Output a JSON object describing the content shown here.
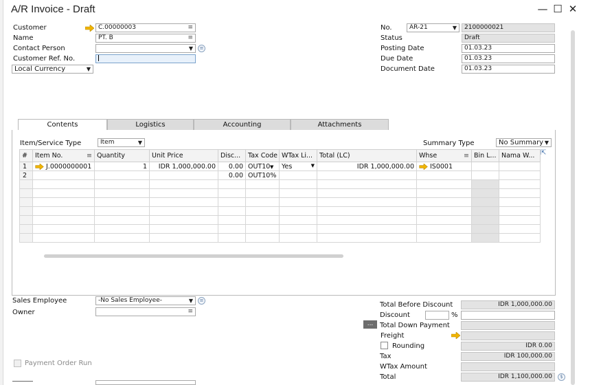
{
  "window": {
    "title": "A/R Invoice - Draft",
    "minimize": "—",
    "maximize": "☐",
    "close": "✕"
  },
  "header_left": {
    "customer": {
      "label": "Customer",
      "value": "C.00000003"
    },
    "name": {
      "label": "Name",
      "value": "PT. B"
    },
    "contact_person": {
      "label": "Contact Person",
      "value": ""
    },
    "customer_ref": {
      "label": "Customer Ref. No.",
      "value": ""
    },
    "currency": {
      "value": "Local Currency"
    }
  },
  "header_right": {
    "no": {
      "label": "No.",
      "series": "AR-21",
      "value": "2100000021"
    },
    "status": {
      "label": "Status",
      "value": "Draft"
    },
    "posting_date": {
      "label": "Posting Date",
      "value": "01.03.23"
    },
    "due_date": {
      "label": "Due Date",
      "value": "01.03.23"
    },
    "document_date": {
      "label": "Document Date",
      "value": "01.03.23"
    }
  },
  "tabs": [
    {
      "label": "Contents",
      "active": true
    },
    {
      "label": "Logistics",
      "active": false
    },
    {
      "label": "Accounting",
      "active": false
    },
    {
      "label": "Attachments",
      "active": false
    }
  ],
  "contents": {
    "item_service_type": {
      "label": "Item/Service Type",
      "value": "Item"
    },
    "summary_type": {
      "label": "Summary Type",
      "value": "No Summary"
    },
    "columns": [
      "#",
      "Item No.",
      "Quantity",
      "Unit Price",
      "Disc...",
      "Tax Code",
      "WTax Li...",
      "Total (LC)",
      "Whse",
      "Bin L...",
      "Nama W..."
    ],
    "rows": [
      {
        "n": "1",
        "item_no": "J.0000000001",
        "quantity": "1",
        "unit_price": "IDR 1,000,000.00",
        "disc": "0.00",
        "tax_code": "OUT10%",
        "wtax": "Yes",
        "total": "IDR 1,000,000.00",
        "whse": "IS0001",
        "bin": "",
        "nama": ""
      },
      {
        "n": "2",
        "item_no": "",
        "quantity": "",
        "unit_price": "",
        "disc": "0.00",
        "tax_code": "OUT10%",
        "wtax": "",
        "total": "",
        "whse": "",
        "bin": "",
        "nama": ""
      }
    ]
  },
  "footer_left": {
    "sales_employee": {
      "label": "Sales Employee",
      "value": "-No Sales Employee-"
    },
    "owner": {
      "label": "Owner",
      "value": ""
    },
    "payment_order_run": {
      "label": "Payment Order Run"
    }
  },
  "totals": {
    "total_before_discount": {
      "label": "Total Before Discount",
      "value": "IDR 1,000,000.00"
    },
    "discount": {
      "label": "Discount",
      "percent_sign": "%",
      "value": ""
    },
    "total_down_payment": {
      "label": "Total Down Payment",
      "value": "",
      "button": "..."
    },
    "freight": {
      "label": "Freight",
      "value": ""
    },
    "rounding": {
      "label": "Rounding",
      "value": "IDR 0.00"
    },
    "tax": {
      "label": "Tax",
      "value": "IDR 100,000.00"
    },
    "wtax_amount": {
      "label": "WTax Amount",
      "value": ""
    },
    "total": {
      "label": "Total",
      "value": "IDR 1,100,000.00"
    }
  },
  "colors": {
    "link_arrow": "#f0b400",
    "gray_field": "#e3e3e3",
    "focus_field": "#e8f1fb"
  }
}
